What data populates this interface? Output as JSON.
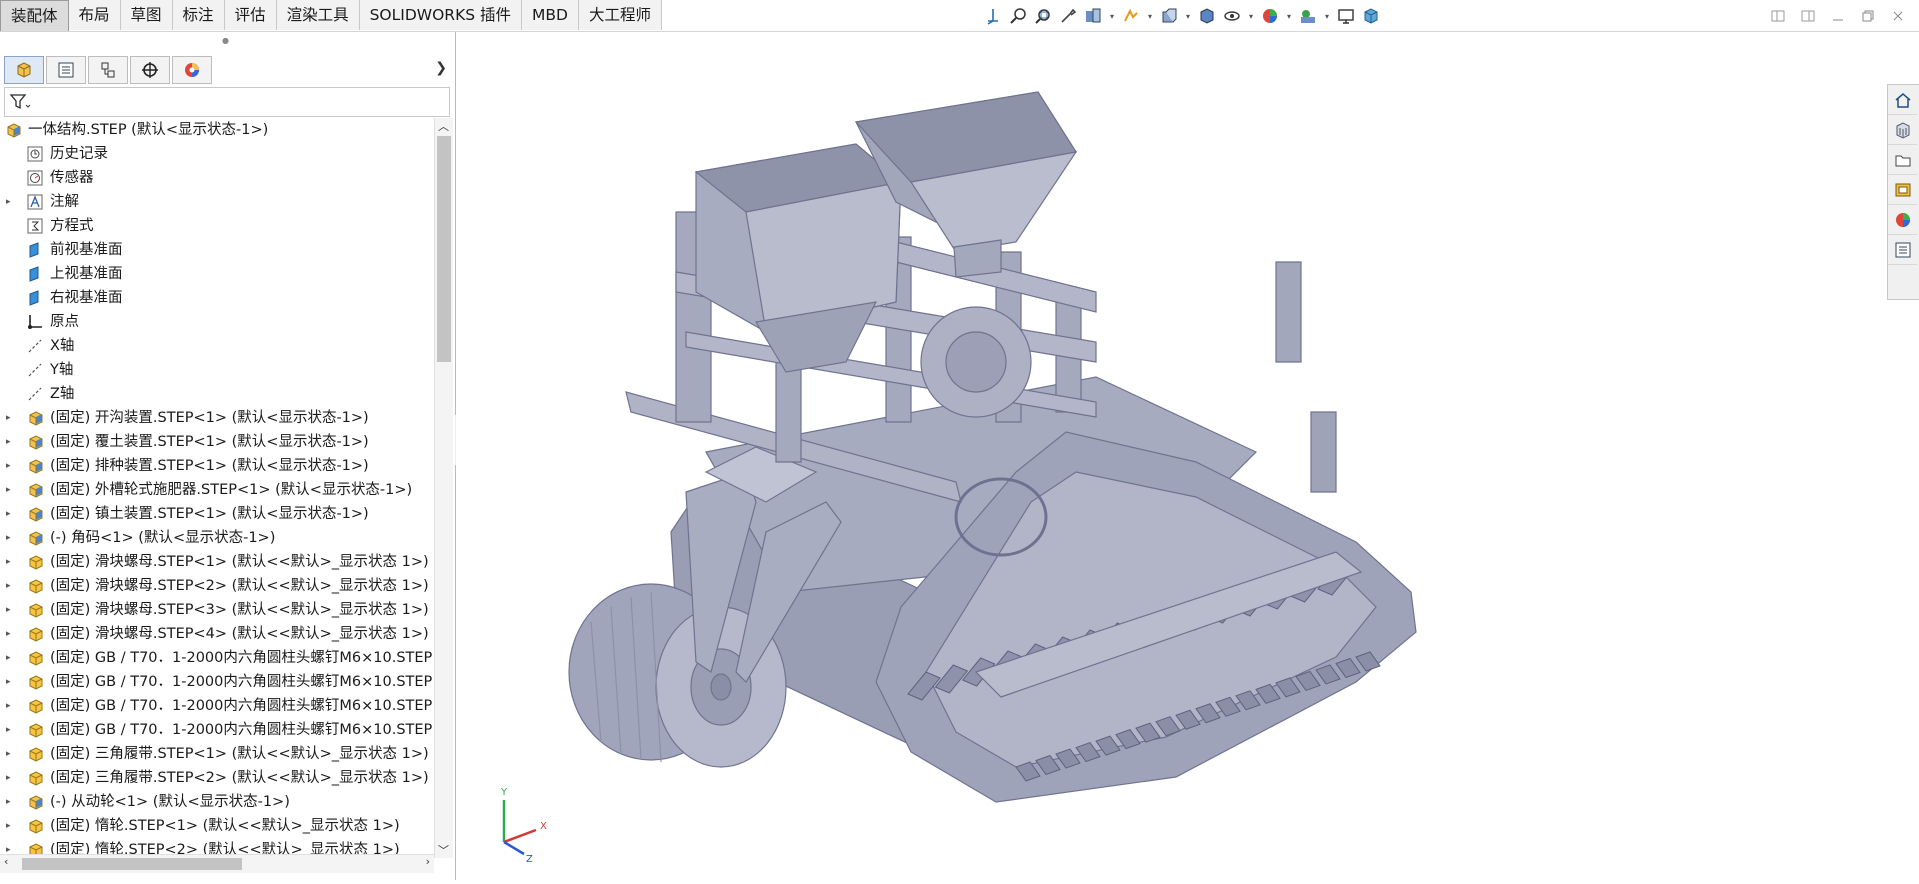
{
  "tabs": [
    "装配体",
    "布局",
    "草图",
    "标注",
    "评估",
    "渲染工具",
    "SOLIDWORKS 插件",
    "MBD",
    "大工程师"
  ],
  "active_tab": "装配体",
  "view_tools": [
    "view-orientation-icon",
    "zoom-to-fit-icon",
    "zoom-to-area-icon",
    "previous-view-icon",
    "section-view-icon",
    "dynamic-annotation-icon",
    "view-setting-icon",
    "display-style-icon",
    "hide-show-icon",
    "edit-appearance-icon",
    "apply-scene-icon",
    "view-settings-icon",
    "3d-view-icon"
  ],
  "panel": {
    "tabs": [
      "featuremanager-icon",
      "propertymanager-icon",
      "configurationmanager-icon",
      "dimxpert-icon",
      "displaymanager-icon"
    ],
    "filter_icon": "filter-icon",
    "tree": [
      {
        "text": "一体结构.STEP  (默认<显示状态-1>)",
        "icon": "assembly",
        "level": 0,
        "arrow": ""
      },
      {
        "text": "历史记录",
        "icon": "history",
        "level": 1,
        "arrow": ""
      },
      {
        "text": "传感器",
        "icon": "sensor",
        "level": 1,
        "arrow": ""
      },
      {
        "text": "注解",
        "icon": "annotation",
        "level": 1,
        "arrow": "▸"
      },
      {
        "text": "方程式",
        "icon": "equation",
        "level": 1,
        "arrow": ""
      },
      {
        "text": "前视基准面",
        "icon": "plane",
        "level": 1,
        "arrow": ""
      },
      {
        "text": "上视基准面",
        "icon": "plane",
        "level": 1,
        "arrow": ""
      },
      {
        "text": "右视基准面",
        "icon": "plane",
        "level": 1,
        "arrow": ""
      },
      {
        "text": "原点",
        "icon": "origin",
        "level": 1,
        "arrow": ""
      },
      {
        "text": "X轴",
        "icon": "axis",
        "level": 1,
        "arrow": ""
      },
      {
        "text": "Y轴",
        "icon": "axis",
        "level": 1,
        "arrow": ""
      },
      {
        "text": "Z轴",
        "icon": "axis",
        "level": 1,
        "arrow": ""
      },
      {
        "text": "(固定) 开沟装置.STEP<1> (默认<显示状态-1>)",
        "icon": "assembly",
        "level": 0,
        "arrow": "▸"
      },
      {
        "text": "(固定) 覆土装置.STEP<1> (默认<显示状态-1>)",
        "icon": "assembly",
        "level": 0,
        "arrow": "▸"
      },
      {
        "text": "(固定) 排种装置.STEP<1> (默认<显示状态-1>)",
        "icon": "assembly",
        "level": 0,
        "arrow": "▸"
      },
      {
        "text": "(固定) 外槽轮式施肥器.STEP<1> (默认<显示状态-1>)",
        "icon": "assembly",
        "level": 0,
        "arrow": "▸"
      },
      {
        "text": "(固定) 镇土装置.STEP<1> (默认<显示状态-1>)",
        "icon": "assembly",
        "level": 0,
        "arrow": "▸"
      },
      {
        "text": "(-) 角码<1> (默认<显示状态-1>)",
        "icon": "assembly",
        "level": 0,
        "arrow": "▸"
      },
      {
        "text": "(固定) 滑块螺母.STEP<1> (默认<<默认>_显示状态 1>)",
        "icon": "part",
        "level": 0,
        "arrow": "▸"
      },
      {
        "text": "(固定) 滑块螺母.STEP<2> (默认<<默认>_显示状态 1>)",
        "icon": "part",
        "level": 0,
        "arrow": "▸"
      },
      {
        "text": "(固定) 滑块螺母.STEP<3> (默认<<默认>_显示状态 1>)",
        "icon": "part",
        "level": 0,
        "arrow": "▸"
      },
      {
        "text": "(固定) 滑块螺母.STEP<4> (默认<<默认>_显示状态 1>)",
        "icon": "part",
        "level": 0,
        "arrow": "▸"
      },
      {
        "text": "(固定) GB / T70．1-2000内六角圆柱头螺钉M6×10.STEP",
        "icon": "part",
        "level": 0,
        "arrow": "▸"
      },
      {
        "text": "(固定) GB / T70．1-2000内六角圆柱头螺钉M6×10.STEP",
        "icon": "part",
        "level": 0,
        "arrow": "▸"
      },
      {
        "text": "(固定) GB / T70．1-2000内六角圆柱头螺钉M6×10.STEP",
        "icon": "part",
        "level": 0,
        "arrow": "▸"
      },
      {
        "text": "(固定) GB / T70．1-2000内六角圆柱头螺钉M6×10.STEP",
        "icon": "part",
        "level": 0,
        "arrow": "▸"
      },
      {
        "text": "(固定) 三角履带.STEP<1> (默认<<默认>_显示状态 1>)",
        "icon": "part",
        "level": 0,
        "arrow": "▸"
      },
      {
        "text": "(固定) 三角履带.STEP<2> (默认<<默认>_显示状态 1>)",
        "icon": "part",
        "level": 0,
        "arrow": "▸"
      },
      {
        "text": "(-) 从动轮<1> (默认<显示状态-1>)",
        "icon": "assembly",
        "level": 0,
        "arrow": "▸"
      },
      {
        "text": "(固定) 惰轮.STEP<1> (默认<<默认>_显示状态 1>)",
        "icon": "part",
        "level": 0,
        "arrow": "▸"
      },
      {
        "text": "(固定) 惰轮.STEP<2> (默认<<默认>_显示状态 1>)",
        "icon": "part",
        "level": 0,
        "arrow": "▸"
      }
    ]
  },
  "viewport": {
    "model_color": "#a3a7bd",
    "triad": {
      "x": "X",
      "y": "Y",
      "z": "Z"
    },
    "taskpane": [
      "home-icon",
      "design-library-icon",
      "file-explorer-icon",
      "view-palette-icon",
      "appearances-icon",
      "custom-properties-icon"
    ]
  },
  "colors": {
    "accent": "#2f6fb5",
    "axis_x": "#d23a3a",
    "axis_y": "#2fa84f",
    "axis_z": "#2a56d6"
  }
}
